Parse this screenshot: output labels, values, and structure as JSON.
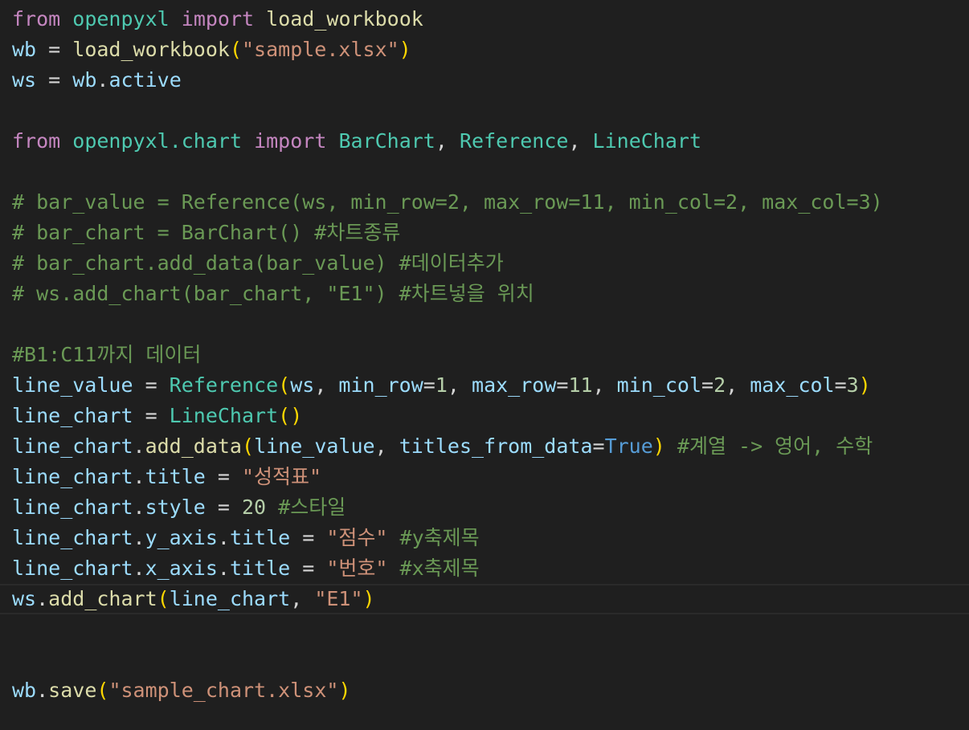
{
  "editor": {
    "lines": [
      [
        {
          "t": "from",
          "c": "kw"
        },
        {
          "t": " ",
          "c": "op"
        },
        {
          "t": "openpyxl",
          "c": "mod"
        },
        {
          "t": " ",
          "c": "op"
        },
        {
          "t": "import",
          "c": "kw"
        },
        {
          "t": " ",
          "c": "op"
        },
        {
          "t": "load_workbook",
          "c": "fn"
        }
      ],
      [
        {
          "t": "wb",
          "c": "var"
        },
        {
          "t": " = ",
          "c": "op"
        },
        {
          "t": "load_workbook",
          "c": "fn"
        },
        {
          "t": "(",
          "c": "br1"
        },
        {
          "t": "\"sample.xlsx\"",
          "c": "str"
        },
        {
          "t": ")",
          "c": "br1"
        }
      ],
      [
        {
          "t": "ws",
          "c": "var"
        },
        {
          "t": " = ",
          "c": "op"
        },
        {
          "t": "wb",
          "c": "var"
        },
        {
          "t": ".",
          "c": "op"
        },
        {
          "t": "active",
          "c": "var"
        }
      ],
      [],
      [
        {
          "t": "from",
          "c": "kw"
        },
        {
          "t": " ",
          "c": "op"
        },
        {
          "t": "openpyxl.chart",
          "c": "mod"
        },
        {
          "t": " ",
          "c": "op"
        },
        {
          "t": "import",
          "c": "kw"
        },
        {
          "t": " ",
          "c": "op"
        },
        {
          "t": "BarChart",
          "c": "mod"
        },
        {
          "t": ", ",
          "c": "op"
        },
        {
          "t": "Reference",
          "c": "mod"
        },
        {
          "t": ", ",
          "c": "op"
        },
        {
          "t": "LineChart",
          "c": "mod"
        }
      ],
      [],
      [
        {
          "t": "# bar_value = Reference(ws, min_row=2, max_row=11, min_col=2, max_col=3)",
          "c": "cmt"
        }
      ],
      [
        {
          "t": "# bar_chart = BarChart() #차트종류",
          "c": "cmt"
        }
      ],
      [
        {
          "t": "# bar_chart.add_data(bar_value) #데이터추가",
          "c": "cmt"
        }
      ],
      [
        {
          "t": "# ws.add_chart(bar_chart, \"E1\") #차트넣을 위치",
          "c": "cmt"
        }
      ],
      [],
      [
        {
          "t": "#B1:C11까지 데이터",
          "c": "cmt"
        }
      ],
      [
        {
          "t": "line_value",
          "c": "var"
        },
        {
          "t": " = ",
          "c": "op"
        },
        {
          "t": "Reference",
          "c": "mod"
        },
        {
          "t": "(",
          "c": "br1"
        },
        {
          "t": "ws",
          "c": "var"
        },
        {
          "t": ", ",
          "c": "op"
        },
        {
          "t": "min_row",
          "c": "var"
        },
        {
          "t": "=",
          "c": "op"
        },
        {
          "t": "1",
          "c": "num"
        },
        {
          "t": ", ",
          "c": "op"
        },
        {
          "t": "max_row",
          "c": "var"
        },
        {
          "t": "=",
          "c": "op"
        },
        {
          "t": "11",
          "c": "num"
        },
        {
          "t": ", ",
          "c": "op"
        },
        {
          "t": "min_col",
          "c": "var"
        },
        {
          "t": "=",
          "c": "op"
        },
        {
          "t": "2",
          "c": "num"
        },
        {
          "t": ", ",
          "c": "op"
        },
        {
          "t": "max_col",
          "c": "var"
        },
        {
          "t": "=",
          "c": "op"
        },
        {
          "t": "3",
          "c": "num"
        },
        {
          "t": ")",
          "c": "br1"
        }
      ],
      [
        {
          "t": "line_chart",
          "c": "var"
        },
        {
          "t": " = ",
          "c": "op"
        },
        {
          "t": "LineChart",
          "c": "mod"
        },
        {
          "t": "()",
          "c": "br1"
        }
      ],
      [
        {
          "t": "line_chart",
          "c": "var"
        },
        {
          "t": ".",
          "c": "op"
        },
        {
          "t": "add_data",
          "c": "fn"
        },
        {
          "t": "(",
          "c": "br1"
        },
        {
          "t": "line_value",
          "c": "var"
        },
        {
          "t": ", ",
          "c": "op"
        },
        {
          "t": "titles_from_data",
          "c": "var"
        },
        {
          "t": "=",
          "c": "op"
        },
        {
          "t": "True",
          "c": "bool"
        },
        {
          "t": ")",
          "c": "br1"
        },
        {
          "t": " ",
          "c": "op"
        },
        {
          "t": "#계열 -> 영어, 수학",
          "c": "cmt"
        }
      ],
      [
        {
          "t": "line_chart",
          "c": "var"
        },
        {
          "t": ".",
          "c": "op"
        },
        {
          "t": "title",
          "c": "var"
        },
        {
          "t": " = ",
          "c": "op"
        },
        {
          "t": "\"성적표\"",
          "c": "str"
        }
      ],
      [
        {
          "t": "line_chart",
          "c": "var"
        },
        {
          "t": ".",
          "c": "op"
        },
        {
          "t": "style",
          "c": "var"
        },
        {
          "t": " = ",
          "c": "op"
        },
        {
          "t": "20",
          "c": "num"
        },
        {
          "t": " ",
          "c": "op"
        },
        {
          "t": "#스타일",
          "c": "cmt"
        }
      ],
      [
        {
          "t": "line_chart",
          "c": "var"
        },
        {
          "t": ".",
          "c": "op"
        },
        {
          "t": "y_axis",
          "c": "var"
        },
        {
          "t": ".",
          "c": "op"
        },
        {
          "t": "title",
          "c": "var"
        },
        {
          "t": " = ",
          "c": "op"
        },
        {
          "t": "\"점수\"",
          "c": "str"
        },
        {
          "t": " ",
          "c": "op"
        },
        {
          "t": "#y축제목",
          "c": "cmt"
        }
      ],
      [
        {
          "t": "line_chart",
          "c": "var"
        },
        {
          "t": ".",
          "c": "op"
        },
        {
          "t": "x_axis",
          "c": "var"
        },
        {
          "t": ".",
          "c": "op"
        },
        {
          "t": "title",
          "c": "var"
        },
        {
          "t": " = ",
          "c": "op"
        },
        {
          "t": "\"번호\"",
          "c": "str"
        },
        {
          "t": " ",
          "c": "op"
        },
        {
          "t": "#x축제목",
          "c": "cmt"
        }
      ],
      [
        {
          "t": "ws",
          "c": "var"
        },
        {
          "t": ".",
          "c": "op"
        },
        {
          "t": "add_chart",
          "c": "fn"
        },
        {
          "t": "(",
          "c": "br1"
        },
        {
          "t": "line_chart",
          "c": "var"
        },
        {
          "t": ", ",
          "c": "op"
        },
        {
          "t": "\"E1\"",
          "c": "str"
        },
        {
          "t": ")",
          "c": "br1"
        }
      ],
      [],
      [],
      [
        {
          "t": "wb",
          "c": "var"
        },
        {
          "t": ".",
          "c": "op"
        },
        {
          "t": "save",
          "c": "fn"
        },
        {
          "t": "(",
          "c": "br1"
        },
        {
          "t": "\"sample_chart.xlsx\"",
          "c": "str"
        },
        {
          "t": ")",
          "c": "br1"
        }
      ]
    ],
    "current_line": 19
  }
}
